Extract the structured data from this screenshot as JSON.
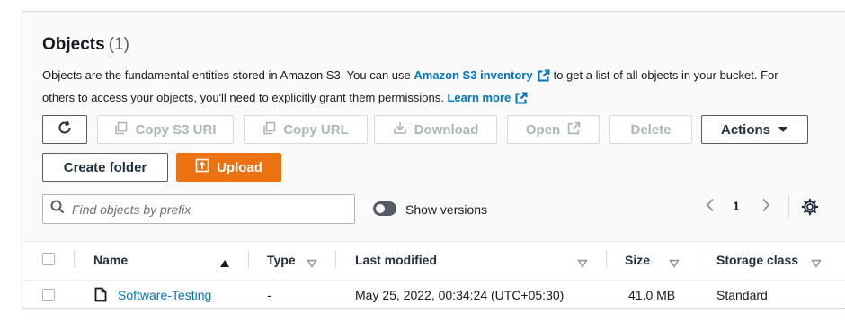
{
  "header": {
    "title": "Objects",
    "count": "(1)"
  },
  "description": {
    "text_1": "Objects are the fundamental entities stored in Amazon S3. You can use",
    "inventory_link": "Amazon S3 inventory",
    "text_2": "to get a list of all objects in your bucket. For",
    "text_3": "others to access your objects, you'll need to explicitly grant them permissions.",
    "learn_more": "Learn more"
  },
  "toolbar": {
    "copy_s3_uri": "Copy S3 URI",
    "copy_url": "Copy URL",
    "download": "Download",
    "open": "Open",
    "delete": "Delete",
    "actions": "Actions",
    "create_folder": "Create folder",
    "upload": "Upload"
  },
  "search": {
    "placeholder": "Find objects by prefix",
    "value": ""
  },
  "versions": {
    "label": "Show versions",
    "enabled": false
  },
  "pagination": {
    "current_page": "1"
  },
  "table": {
    "columns": {
      "name": "Name",
      "type": "Type",
      "last_modified": "Last modified",
      "size": "Size",
      "storage_class": "Storage class"
    },
    "rows": [
      {
        "name": "Software-Testing",
        "type": "-",
        "last_modified": "May 25, 2022, 00:34:24 (UTC+05:30)",
        "size": "41.0 MB",
        "storage_class": "Standard"
      }
    ]
  },
  "colors": {
    "accent": "#ec7211",
    "link": "#0073bb",
    "disabled": "#aab7b8",
    "border": "#545b64"
  }
}
